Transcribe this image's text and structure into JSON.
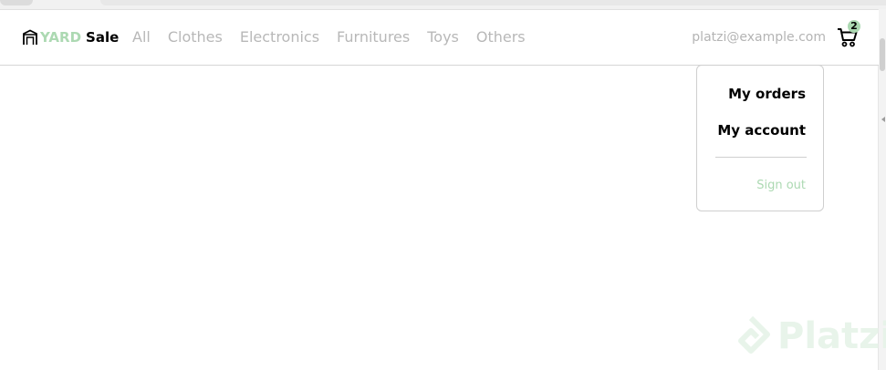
{
  "brand": {
    "part1": "YARD",
    "part2": "Sale",
    "accent_color": "#acd9b2"
  },
  "nav": {
    "links": [
      "All",
      "Clothes",
      "Electronics",
      "Furnitures",
      "Toys",
      "Others"
    ]
  },
  "user": {
    "email": "platzi@example.com"
  },
  "cart": {
    "count": "2",
    "icon": "shopping-cart-icon"
  },
  "menu": {
    "my_orders": "My orders",
    "my_account": "My account",
    "sign_out": "Sign out"
  },
  "watermark": {
    "text": "Platzi"
  }
}
